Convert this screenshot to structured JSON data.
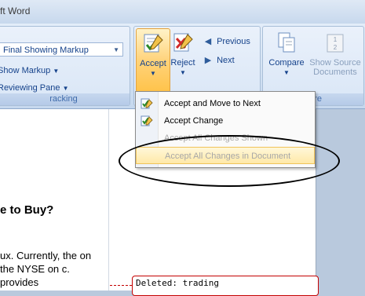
{
  "window": {
    "title": "ft Word"
  },
  "tracking": {
    "markup_select": "Final Showing Markup",
    "show_markup": "Show Markup",
    "reviewing_pane": "Reviewing Pane",
    "group_label": "racking"
  },
  "changes": {
    "accept": "Accept",
    "reject": "Reject",
    "previous": "Previous",
    "next": "Next"
  },
  "compare": {
    "compare": "Compare",
    "show_source_line1": "Show Source",
    "show_source_line2": "Documents",
    "group_label": "pare"
  },
  "accept_menu": {
    "items": [
      {
        "label": "Accept and Move to Next",
        "enabled": true
      },
      {
        "label": "Accept Change",
        "enabled": true
      },
      {
        "label": "Accept All Changes Shown",
        "enabled": false
      },
      {
        "label": "Accept All Changes in Document",
        "enabled": false
      }
    ]
  },
  "document": {
    "heading": "e to Buy?",
    "body": "ux. Currently, the on the NYSE on c. provides",
    "comment": "Deleted: trading"
  },
  "icons": {
    "accept": "accept-check-pencil-icon",
    "reject": "reject-x-pencil-icon",
    "previous": "previous-arrow-icon",
    "next": "next-arrow-icon",
    "compare": "compare-documents-icon",
    "show_source": "show-source-documents-icon"
  },
  "colors": {
    "ribbon_bg": "#d2e1f3",
    "accent": "#ffd37b",
    "deleted_border": "#c40000"
  }
}
